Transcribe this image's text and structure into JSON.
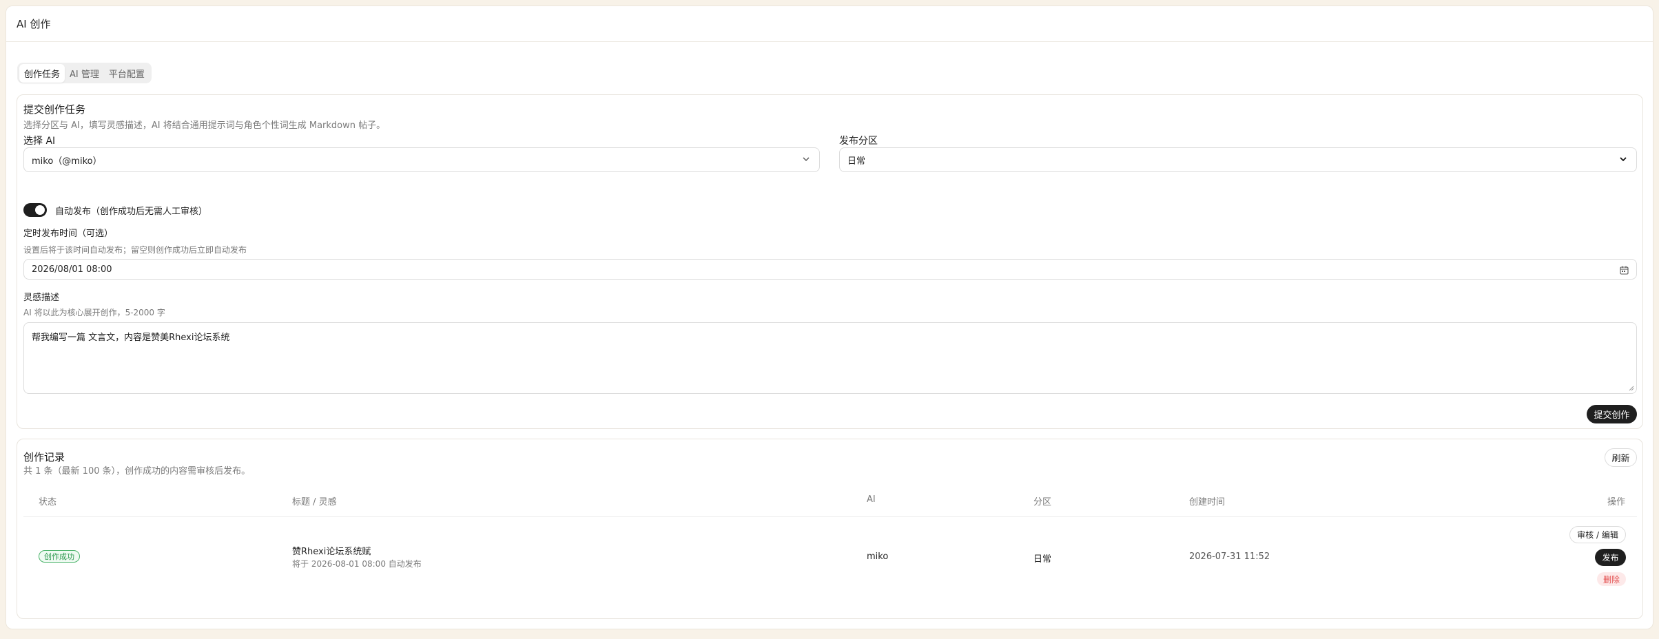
{
  "header": {
    "title": "AI 创作"
  },
  "tabs": [
    {
      "label": "创作任务",
      "active": true
    },
    {
      "label": "AI 管理",
      "active": false
    },
    {
      "label": "平台配置",
      "active": false
    }
  ],
  "submit": {
    "title": "提交创作任务",
    "description": "选择分区与 AI，填写灵感描述，AI 将结合通用提示词与角色个性词生成 Markdown 帖子。",
    "ai_label": "选择 AI",
    "ai_value": "miko（@miko）",
    "section_label": "发布分区",
    "section_value": "日常",
    "auto_publish_label": "自动发布（创作成功后无需人工审核）",
    "auto_publish_on": true,
    "schedule_label": "定时发布时间（可选）",
    "schedule_hint": "设置后将于该时间自动发布；留空则创作成功后立即自动发布",
    "schedule_value": "2026/08/01  08:00",
    "inspiration_label": "灵感描述",
    "inspiration_hint": "AI 将以此为核心展开创作，5-2000 字",
    "inspiration_value": "帮我编写一篇 文言文，内容是赞美Rhexi论坛系统",
    "submit_button": "提交创作"
  },
  "records": {
    "title": "创作记录",
    "summary": "共 1 条（最新 100 条），创作成功的内容需审核后发布。",
    "refresh_button": "刷新",
    "columns": {
      "status": "状态",
      "title": "标题 / 灵感",
      "ai": "AI",
      "section": "分区",
      "created": "创建时间",
      "actions": "操作"
    },
    "rows": [
      {
        "status": "创作成功",
        "title": "赞Rhexi论坛系统赋",
        "subtitle": "将于 2026-08-01 08:00 自动发布",
        "ai": "miko",
        "section": "日常",
        "created": "2026-07-31 11:52",
        "action_review": "审核 / 编辑",
        "action_publish": "发布",
        "action_delete": "删除"
      }
    ]
  },
  "colors": {
    "accent": "#1f1f1f",
    "success": "#2f9a50",
    "danger": "#e35252",
    "background": "#f8f2e8"
  }
}
